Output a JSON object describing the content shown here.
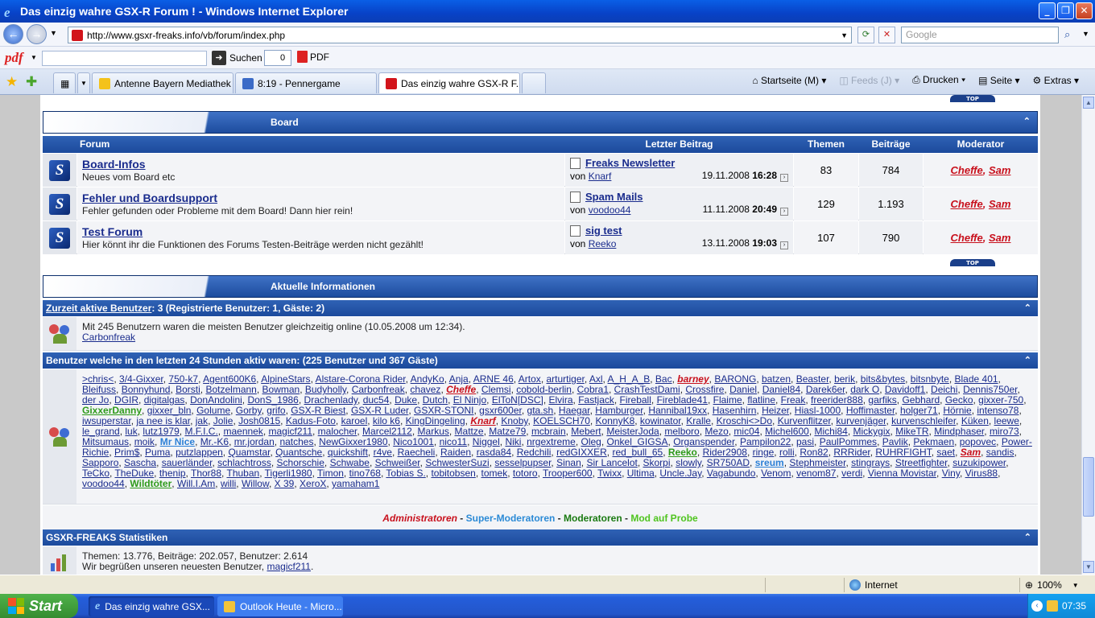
{
  "window": {
    "title": "Das einzig wahre GSX-R Forum ! - Windows Internet Explorer"
  },
  "address": {
    "url": "http://www.gsxr-freaks.info/vb/forum/index.php",
    "search_placeholder": "Google"
  },
  "pdfbar": {
    "logo": "pdf",
    "search_label": "Suchen",
    "counter": "0",
    "pdf_label": "PDF"
  },
  "tabs": [
    {
      "label": "Antenne Bayern Mediathek"
    },
    {
      "label": "8:19 - Pennergame"
    },
    {
      "label": "Das einzig wahre GSX-R F..."
    }
  ],
  "commands": {
    "home": "Startseite (M)",
    "feeds": "Feeds (J)",
    "print": "Drucken",
    "page": "Seite",
    "extras": "Extras"
  },
  "top_label": "TOP",
  "board": {
    "title": "Board",
    "headers": {
      "forum": "Forum",
      "last": "Letzter Beitrag",
      "threads": "Themen",
      "posts": "Beiträge",
      "moderator": "Moderator"
    },
    "rows": [
      {
        "name": "Board-Infos",
        "desc": "Neues vom Board etc",
        "last_title": "Freaks Newsletter",
        "by_label": "von",
        "by": "Knarf",
        "date": "19.11.2008",
        "time": "16:28",
        "threads": "83",
        "posts": "784",
        "mod1": "Cheffe",
        "mod2": "Sam"
      },
      {
        "name": "Fehler und Boardsupport",
        "desc": "Fehler gefunden oder Probleme mit dem Board! Dann hier rein!",
        "last_title": "Spam Mails",
        "by_label": "von",
        "by": "voodoo44",
        "date": "11.11.2008",
        "time": "20:49",
        "threads": "129",
        "posts": "1.193",
        "mod1": "Cheffe",
        "mod2": "Sam"
      },
      {
        "name": "Test Forum",
        "desc": "Hier könnt ihr die Funktionen des Forums Testen-Beiträge werden nicht gezählt!",
        "last_title": "sig test",
        "by_label": "von",
        "by": "Reeko",
        "date": "13.11.2008",
        "time": "19:03",
        "threads": "107",
        "posts": "790",
        "mod1": "Cheffe",
        "mod2": "Sam"
      }
    ]
  },
  "info": {
    "title": "Aktuelle Informationen",
    "active_link": "Zurzeit aktive Benutzer",
    "active_rest": ": 3 (Registrierte Benutzer: 1, Gäste: 2)",
    "record_text": "Mit 245 Benutzern waren die meisten Benutzer gleichzeitig online (10.05.2008 um 12:34).",
    "record_user": "Carbonfreak",
    "last24": "Benutzer welche in den letzten 24 Stunden aktiv waren: (225 Benutzer und 367 Gäste)",
    "legend": {
      "admins": "Administratoren",
      "supermods": "Super-Moderatoren",
      "mods": "Moderatoren",
      "probe": "Mod auf Probe",
      "sep": " - "
    }
  },
  "users_24h": [
    ">chris<",
    "3/4-Gixxer",
    "750-k7",
    "Agent600K6",
    "AlpineStars",
    "Alstare-Corona Rider",
    "AndyKo",
    "Anja",
    "ARNE 46",
    "Artox",
    "arturtiger",
    "Axl",
    "A_H_A_B",
    "Bac",
    "barney",
    "BARONG",
    "batzen",
    "Beaster",
    "berik",
    "bits&bytes",
    "bitsnbyte",
    "Blade 401",
    "Bleifuss",
    "Bonnyhund",
    "Borsti",
    "Botzelmann",
    "Bowman",
    "Budyholly",
    "Carbonfreak",
    "chavez",
    "Cheffe",
    "Clemsi",
    "cobold-berlin",
    "Cobra1",
    "CrashTestDami",
    "Crossfire",
    "Daniel",
    "Daniel84",
    "Darek6er",
    "dark O",
    "Davidoff1",
    "Deichi",
    "Dennis750er",
    "der Jo",
    "DGIR",
    "digitalgas",
    "DonAndolini",
    "DonS_1986",
    "Drachenlady",
    "duc54",
    "Duke",
    "Dutch",
    "El Ninjo",
    "ElToN[DSC]",
    "Elvira",
    "Fastjack",
    "Fireball",
    "Fireblade41",
    "Flaime",
    "flatline",
    "Freak",
    "freerider888",
    "garfiks",
    "Gebhard",
    "Gecko",
    "gixxer-750",
    "GixxerDanny",
    "gixxer_bln",
    "Golume",
    "Gorby",
    "grifo",
    "GSX-R Biest",
    "GSX-R Luder",
    "GSXR-STONI",
    "gsxr600er",
    "gta.sh",
    "Haegar",
    "Hamburger",
    "Hannibal19xx",
    "Hasenhirn",
    "Heizer",
    "Hiasl-1000",
    "Hoffimaster",
    "holger71",
    "Hörnie",
    "intenso78",
    "iwsuperstar",
    "ja nee is klar",
    "jak",
    "Jolie",
    "Josh0815",
    "Kadus-Foto",
    "karoel",
    "kilo k6",
    "KingDingeling",
    "Knarf",
    "Knoby",
    "KOELSCH70",
    "KonnyK8",
    "kowinator",
    "Kralle",
    "Kroschi<>Do",
    "Kurvenflitzer",
    "kurvenjäger",
    "kurvenschleifer",
    "Küken",
    "leewe",
    "le_grand",
    "luk",
    "lutz1979",
    "M.F.I.C.",
    "maennek",
    "magicf211",
    "malocher",
    "Marcel2112",
    "Markus",
    "Mattze",
    "Matze79",
    "mcbrain",
    "Mebert",
    "MeisterJoda",
    "melboro",
    "Mezo",
    "mic04",
    "Michel600",
    "Michi84",
    "Mickygix",
    "MikeTR",
    "Mindphaser",
    "miro73",
    "Mitsumaus",
    "moik",
    "Mr Nice",
    "Mr.-K6",
    "mr.jordan",
    "natches",
    "NewGixxer1980",
    "Nico1001",
    "nico11",
    "Niggel",
    "Niki",
    "nrgextreme",
    "Oleg",
    "Onkel_GIGSA",
    "Organspender",
    "Pampilon22",
    "pasi",
    "PaulPommes",
    "Pavlik",
    "Pekmaen",
    "popovec",
    "Power-Richie",
    "Prim$",
    "Puma",
    "putzlappen",
    "Quamstar",
    "Quantsche",
    "quickshift",
    "r4ve",
    "Raecheli",
    "Raiden",
    "rasda84",
    "Redchili",
    "redGIXXER",
    "red_bull_65",
    "Reeko",
    "Rider2908",
    "ringe",
    "rolli",
    "Ron82",
    "RRRider",
    "RUHRFIGHT",
    "saet",
    "Sam",
    "sandis",
    "Sapporo",
    "Sascha",
    "sauerländer",
    "schlachtross",
    "Schorschie",
    "Schwabe",
    "Schweißer",
    "SchwesterSuzi",
    "sesselpupser",
    "Sinan",
    "Sir Lancelot",
    "Skorpi",
    "slowly",
    "SR750AD",
    "sreum",
    "Stephmeister",
    "stingrays",
    "Streetfighter",
    "suzukipower",
    "TeCko",
    "TheDuke",
    "thenip",
    "Thor88",
    "Thuban",
    "Tigerli1980",
    "Timon",
    "tino768",
    "Tobias S.",
    "tobitobsen",
    "tomek",
    "totoro",
    "Trooper600",
    "Twixx",
    "Ultima",
    "Uncle.Jay",
    "Vagabundo",
    "Venom",
    "venom87",
    "verdi",
    "Vienna Movistar",
    "Viny",
    "Virus88",
    "voodoo44",
    "Wildtöter",
    "Will.I.Am",
    "willi",
    "Willow",
    "X 39",
    "XeroX",
    "yamaham1"
  ],
  "user_roles": {
    "barney": "adm",
    "Cheffe": "adm",
    "Knarf": "adm",
    "Sam": "adm",
    "GixxerDanny": "mod",
    "Reeko": "mod",
    "Wildtöter": "mod",
    "Mr Nice": "sm",
    "sreum": "sm"
  },
  "stats": {
    "title": "GSXR-FREAKS Statistiken",
    "line1": "Themen: 13.776, Beiträge: 202.057, Benutzer: 2.614",
    "welcome": "Wir begrüßen unseren neuesten Benutzer,",
    "newest": "magicf211"
  },
  "statusbar": {
    "zone": "Internet",
    "zoom": "100%"
  },
  "taskbar": {
    "start": "Start",
    "task1": "Das einzig wahre GSX...",
    "task2": "Outlook Heute - Micro...",
    "clock": "07:35"
  },
  "colors": {
    "forum_blue": "#1d4c9e",
    "admin_red": "#c8101c",
    "mod_green": "#2e9a1a",
    "supermod_blue": "#2b8ad6"
  }
}
